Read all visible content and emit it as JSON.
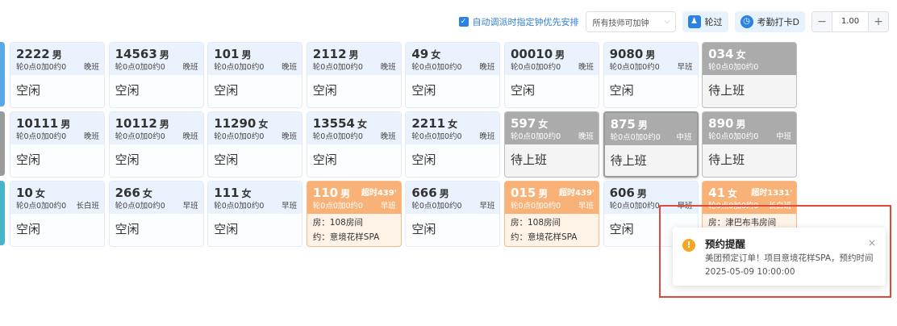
{
  "toolbar": {
    "auto_dispatch_label": "自动调派时指定钟优先安排",
    "auto_dispatch_checked": true,
    "tech_filter_selected": "所有技师可加钟",
    "skip_label": "轮过",
    "attendance_label": "考勤打卡D",
    "stepper_value": "1.00",
    "minus": "−",
    "plus": "+"
  },
  "techs": [
    {
      "num": "2222",
      "sex": "男",
      "stats": "轮0点0加0约0",
      "shift": "晚班",
      "status": "空闲",
      "state": "idle"
    },
    {
      "num": "14563",
      "sex": "男",
      "stats": "轮0点0加0约0",
      "shift": "晚班",
      "status": "空闲",
      "state": "idle"
    },
    {
      "num": "101",
      "sex": "男",
      "stats": "轮0点0加0约0",
      "shift": "晚班",
      "status": "空闲",
      "state": "idle"
    },
    {
      "num": "2112",
      "sex": "男",
      "stats": "轮0点0加0约0",
      "shift": "晚班",
      "status": "空闲",
      "state": "idle"
    },
    {
      "num": "49",
      "sex": "女",
      "stats": "轮0点0加0约0",
      "shift": "晚班",
      "status": "空闲",
      "state": "idle"
    },
    {
      "num": "00010",
      "sex": "男",
      "stats": "轮0点0加0约0",
      "shift": "晚班",
      "status": "空闲",
      "state": "idle"
    },
    {
      "num": "9080",
      "sex": "男",
      "stats": "轮0点0加0约0",
      "shift": "早班",
      "status": "空闲",
      "state": "idle"
    },
    {
      "num": "034",
      "sex": "女",
      "stats": "轮0点0加0约0",
      "shift": "",
      "status": "待上班",
      "state": "offduty"
    },
    {
      "num": "10111",
      "sex": "男",
      "stats": "轮0点0加0约0",
      "shift": "晚班",
      "status": "空闲",
      "state": "idle"
    },
    {
      "num": "10112",
      "sex": "男",
      "stats": "轮0点0加0约0",
      "shift": "晚班",
      "status": "空闲",
      "state": "idle"
    },
    {
      "num": "11290",
      "sex": "女",
      "stats": "轮0点0加0约0",
      "shift": "晚班",
      "status": "空闲",
      "state": "idle"
    },
    {
      "num": "13554",
      "sex": "女",
      "stats": "轮0点0加0约0",
      "shift": "晚班",
      "status": "空闲",
      "state": "idle"
    },
    {
      "num": "2211",
      "sex": "女",
      "stats": "轮0点0加0约0",
      "shift": "晚班",
      "status": "空闲",
      "state": "idle"
    },
    {
      "num": "597",
      "sex": "女",
      "stats": "轮0点0加0约0",
      "shift": "晚班",
      "status": "待上班",
      "state": "offduty"
    },
    {
      "num": "875",
      "sex": "男",
      "stats": "轮0点0加0约0",
      "shift": "中班",
      "status": "待上班",
      "state": "offduty-selected"
    },
    {
      "num": "890",
      "sex": "男",
      "stats": "轮0点0加0约0",
      "shift": "中班",
      "status": "待上班",
      "state": "offduty"
    },
    {
      "num": "10",
      "sex": "女",
      "stats": "轮0点0加0约0",
      "shift": "长白班",
      "status": "空闲",
      "state": "idle"
    },
    {
      "num": "266",
      "sex": "女",
      "stats": "轮0点0加0约0",
      "shift": "早班",
      "status": "空闲",
      "state": "idle"
    },
    {
      "num": "111",
      "sex": "女",
      "stats": "轮0点0加0约0",
      "shift": "早班",
      "status": "空闲",
      "state": "idle"
    },
    {
      "num": "110",
      "sex": "男",
      "overtime": "超时439'",
      "stats": "轮0点0加0约0",
      "shift": "早班",
      "room": "房：108房间",
      "appointment": "约：意境花样SPA",
      "state": "busy"
    },
    {
      "num": "666",
      "sex": "男",
      "stats": "轮0点0加0约0",
      "shift": "早班",
      "status": "空闲",
      "state": "idle"
    },
    {
      "num": "015",
      "sex": "男",
      "overtime": "超时439'",
      "stats": "轮0点0加0约0",
      "shift": "早班",
      "room": "房：108房间",
      "appointment": "约：意境花样SPA",
      "state": "busy"
    },
    {
      "num": "606",
      "sex": "男",
      "stats": "轮0点0加0约0",
      "shift": "早班",
      "status": "空闲",
      "state": "idle"
    },
    {
      "num": "41",
      "sex": "女",
      "overtime": "超时1331'",
      "stats": "轮0点0加0约0",
      "shift": "长白班",
      "room": "房：津巴布韦房间",
      "appointment": "",
      "state": "busy"
    }
  ],
  "edge_colors": [
    "#5aa7e6",
    "#9a9a9a",
    "#46b5c9"
  ],
  "notification": {
    "title": "预约提醒",
    "message": "美团预定订单！项目意境花样SPA，预约时间2025-05-09 10:00:00",
    "close": "×",
    "warn_glyph": "!"
  },
  "colors": {
    "idle_header": "#eaf3fd",
    "offduty_header": "#ababab",
    "busy_header": "#f8b277",
    "highlight_border": "#e04a3a",
    "accent": "#2a82e4"
  }
}
